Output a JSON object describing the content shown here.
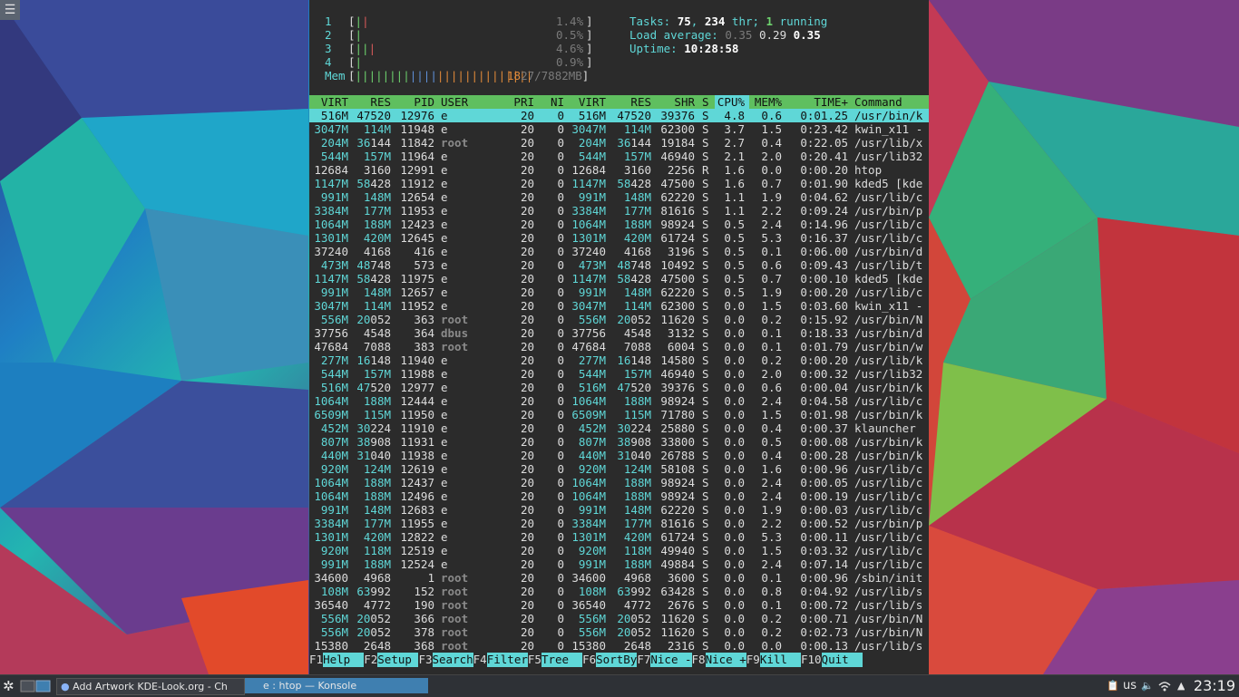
{
  "meters": {
    "cpus": [
      {
        "label": "1",
        "bars": [
          [
            "g",
            "|"
          ],
          [
            "r",
            "|"
          ]
        ],
        "pct": "1.4%"
      },
      {
        "label": "2",
        "bars": [
          [
            "g",
            "|"
          ]
        ],
        "pct": "0.5%"
      },
      {
        "label": "3",
        "bars": [
          [
            "g",
            "||"
          ],
          [
            "r",
            "|"
          ]
        ],
        "pct": "4.6%"
      },
      {
        "label": "4",
        "bars": [
          [
            "g",
            "|"
          ]
        ],
        "pct": "0.9%"
      }
    ],
    "mem": {
      "label": "Mem",
      "bars_green": "||||||||",
      "bars_blue": "||||",
      "bars_orange": "||||||||||||||",
      "value": "1827/7882MB"
    },
    "tasks_label": "Tasks:",
    "tasks": "75",
    "thr_sep": ",",
    "thr": "234",
    "thr_label": "thr;",
    "running": "1",
    "running_label": "running",
    "load_label": "Load average:",
    "load1": "0.35",
    "load5": "0.29",
    "load15": "0.35",
    "uptime_label": "Uptime:",
    "uptime": "10:28:58"
  },
  "table": {
    "headers": [
      "VIRT",
      "RES",
      "PID",
      "USER",
      "PRI",
      "NI",
      "VIRT",
      "RES",
      "SHR",
      "S",
      "CPU%",
      "MEM%",
      "TIME+",
      "Command"
    ],
    "rows": [
      [
        "516M",
        "47520",
        "12976",
        "e",
        "20",
        "0",
        "516M",
        "47520",
        "39376",
        "S",
        "4.8",
        "0.6",
        "0:01.25",
        "/usr/bin/k"
      ],
      [
        "3047M",
        "114M",
        "11948",
        "e",
        "20",
        "0",
        "3047M",
        "114M",
        "62300",
        "S",
        "3.7",
        "1.5",
        "0:23.42",
        "kwin_x11 -"
      ],
      [
        "204M",
        "36144",
        "11842",
        "root",
        "20",
        "0",
        "204M",
        "36144",
        "19184",
        "S",
        "2.7",
        "0.4",
        "0:22.05",
        "/usr/lib/x"
      ],
      [
        "544M",
        "157M",
        "11964",
        "e",
        "20",
        "0",
        "544M",
        "157M",
        "46940",
        "S",
        "2.1",
        "2.0",
        "0:20.41",
        "/usr/lib32"
      ],
      [
        "12684",
        "3160",
        "12991",
        "e",
        "20",
        "0",
        "12684",
        "3160",
        "2256",
        "R",
        "1.6",
        "0.0",
        "0:00.20",
        "htop"
      ],
      [
        "1147M",
        "58428",
        "11912",
        "e",
        "20",
        "0",
        "1147M",
        "58428",
        "47500",
        "S",
        "1.6",
        "0.7",
        "0:01.90",
        "kded5 [kde"
      ],
      [
        "991M",
        "148M",
        "12654",
        "e",
        "20",
        "0",
        "991M",
        "148M",
        "62220",
        "S",
        "1.1",
        "1.9",
        "0:04.62",
        "/usr/lib/c"
      ],
      [
        "3384M",
        "177M",
        "11953",
        "e",
        "20",
        "0",
        "3384M",
        "177M",
        "81616",
        "S",
        "1.1",
        "2.2",
        "0:09.24",
        "/usr/bin/p"
      ],
      [
        "1064M",
        "188M",
        "12423",
        "e",
        "20",
        "0",
        "1064M",
        "188M",
        "98924",
        "S",
        "0.5",
        "2.4",
        "0:14.96",
        "/usr/lib/c"
      ],
      [
        "1301M",
        "420M",
        "12645",
        "e",
        "20",
        "0",
        "1301M",
        "420M",
        "61724",
        "S",
        "0.5",
        "5.3",
        "0:16.37",
        "/usr/lib/c"
      ],
      [
        "37240",
        "4168",
        "416",
        "e",
        "20",
        "0",
        "37240",
        "4168",
        "3196",
        "S",
        "0.5",
        "0.1",
        "0:06.00",
        "/usr/bin/d"
      ],
      [
        "473M",
        "48748",
        "573",
        "e",
        "20",
        "0",
        "473M",
        "48748",
        "10492",
        "S",
        "0.5",
        "0.6",
        "0:09.43",
        "/usr/lib/t"
      ],
      [
        "1147M",
        "58428",
        "11975",
        "e",
        "20",
        "0",
        "1147M",
        "58428",
        "47500",
        "S",
        "0.5",
        "0.7",
        "0:00.10",
        "kded5 [kde"
      ],
      [
        "991M",
        "148M",
        "12657",
        "e",
        "20",
        "0",
        "991M",
        "148M",
        "62220",
        "S",
        "0.5",
        "1.9",
        "0:00.20",
        "/usr/lib/c"
      ],
      [
        "3047M",
        "114M",
        "11952",
        "e",
        "20",
        "0",
        "3047M",
        "114M",
        "62300",
        "S",
        "0.0",
        "1.5",
        "0:03.60",
        "kwin_x11 -"
      ],
      [
        "556M",
        "20052",
        "363",
        "root",
        "20",
        "0",
        "556M",
        "20052",
        "11620",
        "S",
        "0.0",
        "0.2",
        "0:15.92",
        "/usr/bin/N"
      ],
      [
        "37756",
        "4548",
        "364",
        "dbus",
        "20",
        "0",
        "37756",
        "4548",
        "3132",
        "S",
        "0.0",
        "0.1",
        "0:18.33",
        "/usr/bin/d"
      ],
      [
        "47684",
        "7088",
        "383",
        "root",
        "20",
        "0",
        "47684",
        "7088",
        "6004",
        "S",
        "0.0",
        "0.1",
        "0:01.79",
        "/usr/bin/w"
      ],
      [
        "277M",
        "16148",
        "11940",
        "e",
        "20",
        "0",
        "277M",
        "16148",
        "14580",
        "S",
        "0.0",
        "0.2",
        "0:00.20",
        "/usr/lib/k"
      ],
      [
        "544M",
        "157M",
        "11988",
        "e",
        "20",
        "0",
        "544M",
        "157M",
        "46940",
        "S",
        "0.0",
        "2.0",
        "0:00.32",
        "/usr/lib32"
      ],
      [
        "516M",
        "47520",
        "12977",
        "e",
        "20",
        "0",
        "516M",
        "47520",
        "39376",
        "S",
        "0.0",
        "0.6",
        "0:00.04",
        "/usr/bin/k"
      ],
      [
        "1064M",
        "188M",
        "12444",
        "e",
        "20",
        "0",
        "1064M",
        "188M",
        "98924",
        "S",
        "0.0",
        "2.4",
        "0:04.58",
        "/usr/lib/c"
      ],
      [
        "6509M",
        "115M",
        "11950",
        "e",
        "20",
        "0",
        "6509M",
        "115M",
        "71780",
        "S",
        "0.0",
        "1.5",
        "0:01.98",
        "/usr/bin/k"
      ],
      [
        "452M",
        "30224",
        "11910",
        "e",
        "20",
        "0",
        "452M",
        "30224",
        "25880",
        "S",
        "0.0",
        "0.4",
        "0:00.37",
        "klauncher"
      ],
      [
        "807M",
        "38908",
        "11931",
        "e",
        "20",
        "0",
        "807M",
        "38908",
        "33800",
        "S",
        "0.0",
        "0.5",
        "0:00.08",
        "/usr/bin/k"
      ],
      [
        "440M",
        "31040",
        "11938",
        "e",
        "20",
        "0",
        "440M",
        "31040",
        "26788",
        "S",
        "0.0",
        "0.4",
        "0:00.28",
        "/usr/bin/k"
      ],
      [
        "920M",
        "124M",
        "12619",
        "e",
        "20",
        "0",
        "920M",
        "124M",
        "58108",
        "S",
        "0.0",
        "1.6",
        "0:00.96",
        "/usr/lib/c"
      ],
      [
        "1064M",
        "188M",
        "12437",
        "e",
        "20",
        "0",
        "1064M",
        "188M",
        "98924",
        "S",
        "0.0",
        "2.4",
        "0:00.05",
        "/usr/lib/c"
      ],
      [
        "1064M",
        "188M",
        "12496",
        "e",
        "20",
        "0",
        "1064M",
        "188M",
        "98924",
        "S",
        "0.0",
        "2.4",
        "0:00.19",
        "/usr/lib/c"
      ],
      [
        "991M",
        "148M",
        "12683",
        "e",
        "20",
        "0",
        "991M",
        "148M",
        "62220",
        "S",
        "0.0",
        "1.9",
        "0:00.03",
        "/usr/lib/c"
      ],
      [
        "3384M",
        "177M",
        "11955",
        "e",
        "20",
        "0",
        "3384M",
        "177M",
        "81616",
        "S",
        "0.0",
        "2.2",
        "0:00.52",
        "/usr/bin/p"
      ],
      [
        "1301M",
        "420M",
        "12822",
        "e",
        "20",
        "0",
        "1301M",
        "420M",
        "61724",
        "S",
        "0.0",
        "5.3",
        "0:00.11",
        "/usr/lib/c"
      ],
      [
        "920M",
        "118M",
        "12519",
        "e",
        "20",
        "0",
        "920M",
        "118M",
        "49940",
        "S",
        "0.0",
        "1.5",
        "0:03.32",
        "/usr/lib/c"
      ],
      [
        "991M",
        "188M",
        "12524",
        "e",
        "20",
        "0",
        "991M",
        "188M",
        "49884",
        "S",
        "0.0",
        "2.4",
        "0:07.14",
        "/usr/lib/c"
      ],
      [
        "34600",
        "4968",
        "1",
        "root",
        "20",
        "0",
        "34600",
        "4968",
        "3600",
        "S",
        "0.0",
        "0.1",
        "0:00.96",
        "/sbin/init"
      ],
      [
        "108M",
        "63992",
        "152",
        "root",
        "20",
        "0",
        "108M",
        "63992",
        "63428",
        "S",
        "0.0",
        "0.8",
        "0:04.92",
        "/usr/lib/s"
      ],
      [
        "36540",
        "4772",
        "190",
        "root",
        "20",
        "0",
        "36540",
        "4772",
        "2676",
        "S",
        "0.0",
        "0.1",
        "0:00.72",
        "/usr/lib/s"
      ],
      [
        "556M",
        "20052",
        "366",
        "root",
        "20",
        "0",
        "556M",
        "20052",
        "11620",
        "S",
        "0.0",
        "0.2",
        "0:00.71",
        "/usr/bin/N"
      ],
      [
        "556M",
        "20052",
        "378",
        "root",
        "20",
        "0",
        "556M",
        "20052",
        "11620",
        "S",
        "0.0",
        "0.2",
        "0:02.73",
        "/usr/bin/N"
      ],
      [
        "15380",
        "2648",
        "368",
        "root",
        "20",
        "0",
        "15380",
        "2648",
        "2316",
        "S",
        "0.0",
        "0.0",
        "0:00.13",
        "/usr/lib/s"
      ]
    ]
  },
  "fkeys": [
    {
      "k": "F1",
      "l": "Help  "
    },
    {
      "k": "F2",
      "l": "Setup "
    },
    {
      "k": "F3",
      "l": "Search"
    },
    {
      "k": "F4",
      "l": "Filter"
    },
    {
      "k": "F5",
      "l": "Tree  "
    },
    {
      "k": "F6",
      "l": "SortBy"
    },
    {
      "k": "F7",
      "l": "Nice -"
    },
    {
      "k": "F8",
      "l": "Nice +"
    },
    {
      "k": "F9",
      "l": "Kill  "
    },
    {
      "k": "F10",
      "l": "Quit  "
    }
  ],
  "taskbar": {
    "browser_task": "Add  Artwork KDE-Look.org - Ch",
    "konsole_task": "e : htop — Konsole",
    "keyboard_layout": "us",
    "clock": "23:19"
  },
  "icons": {
    "menu": "hamburger-icon",
    "launcher": "kde-gear-icon"
  }
}
